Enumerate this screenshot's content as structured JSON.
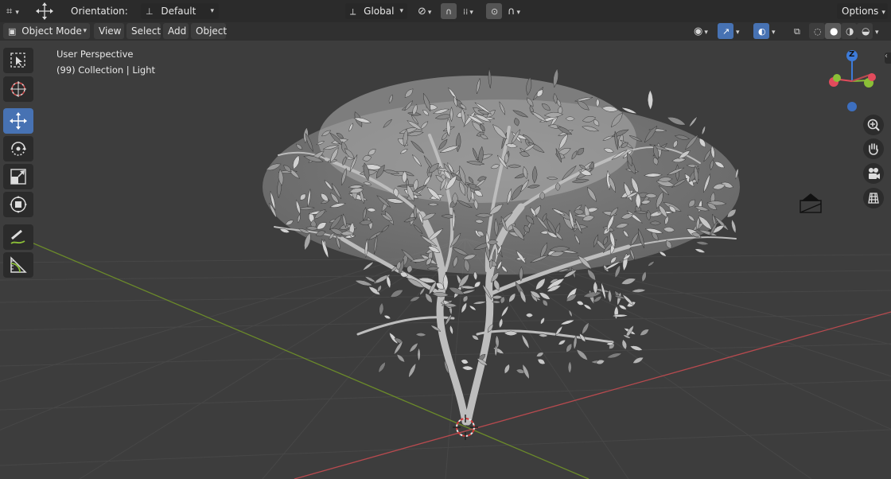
{
  "topbar": {
    "orientation_label": "Orientation:",
    "orientation_value": "Default",
    "transform_space": "Global",
    "options_label": "Options"
  },
  "header": {
    "mode": "Object Mode",
    "menus": [
      "View",
      "Select",
      "Add",
      "Object"
    ]
  },
  "viewport": {
    "view_name": "User Perspective",
    "collection_info": "(99) Collection | Light"
  },
  "gizmo": {
    "z_label": "Z",
    "colors": {
      "x": "#e24b5c",
      "y": "#8bbf37",
      "z": "#3d7bd9"
    }
  },
  "tools": [
    "select-box",
    "cursor",
    "move",
    "rotate",
    "scale",
    "transform",
    "annotate",
    "measure"
  ],
  "colors": {
    "accent": "#4772b3",
    "x_axis": "#b84a4f",
    "y_axis": "#6b8a2a",
    "grid": "#474747"
  }
}
